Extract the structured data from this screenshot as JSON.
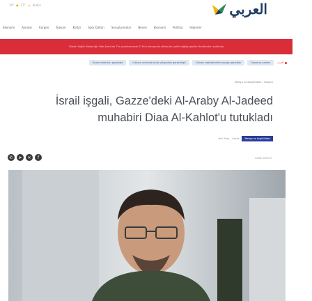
{
  "header": {
    "weather": [
      "10°",
      "17°",
      "Kudüs"
    ],
    "logo_text": "العربي",
    "logo_icon": "bird-logo-icon"
  },
  "nav": {
    "items": [
      "Ekonomi",
      "Aynalar",
      "Kargım",
      "Toplum",
      "Kültür",
      "Spor Dalları",
      "Soruşturmalar",
      "Nesne",
      "Ekonomi",
      "Politika",
      "Haberler"
    ],
    "menu_icon": "hamburger-menu-icon"
  },
  "alert": {
    "text": "Filistin Sağlık Bakanlığı: Batı Şeria'da 7'si yaralanmandı El Fa'a kampında altmış bir şehit sağlığı geçileri tarafından saldırıda"
  },
  "tags": {
    "live_label": "الحدث",
    "items": [
      "Gazze saldırıları geçmişte",
      "Lübnan sınırında sıcak çatışmalar gerçekleşti",
      "Lübnan cephesindeki savaşa geçmişte",
      "Gazze'ye yardım"
    ]
  },
  "breadcrumb": "Medya ve özgürlükler  ‹  Kargım",
  "article": {
    "headline": "İsrail işgali, Gazze'deki Al-Araby Al-Jadeed muhabiri Diaa Al-Kahlot'u tutukladı",
    "meta_text": "Yeni Arap – Gazze",
    "badge": "Medya ve özgürlükler",
    "date": "Aralık 2023 07"
  },
  "share": {
    "buttons": [
      "whatsapp-icon",
      "telegram-icon",
      "x-icon",
      "facebook-icon"
    ],
    "glyphs": [
      "✆",
      "➤",
      "✕",
      "f"
    ]
  },
  "colors": {
    "brand_blue": "#1c3b63",
    "alert_red": "#d92e3a",
    "badge_blue": "#2a3d9a"
  }
}
